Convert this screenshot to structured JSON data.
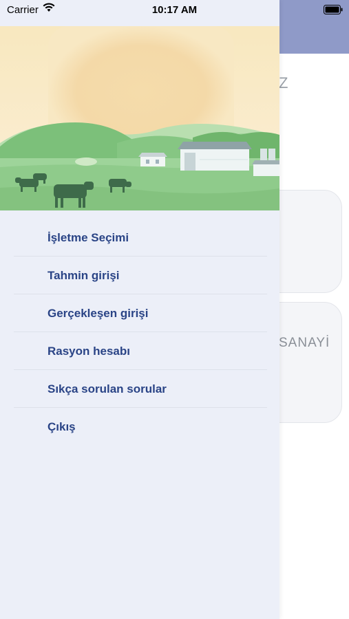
{
  "status_bar": {
    "carrier": "Carrier",
    "time": "10:17 AM"
  },
  "background": {
    "faded_title": "Z",
    "card_text": "SANAYİ"
  },
  "menu": {
    "items": [
      {
        "label": "İşletme Seçimi"
      },
      {
        "label": "Tahmin girişi"
      },
      {
        "label": "Gerçekleşen girişi"
      },
      {
        "label": "Rasyon hesabı"
      },
      {
        "label": "Sıkça sorulan sorular"
      },
      {
        "label": "Çıkış"
      }
    ]
  },
  "colors": {
    "header_bg": "#8f9ac8",
    "drawer_bg": "#eceff8",
    "menu_text": "#2a4486"
  },
  "icons": [
    "wifi-icon",
    "battery-icon",
    "farm-illustration"
  ]
}
